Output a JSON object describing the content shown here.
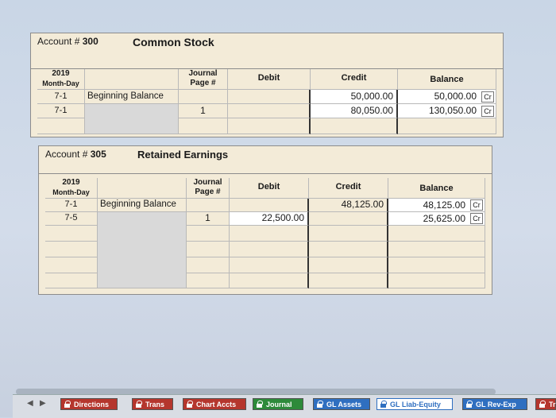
{
  "account1": {
    "label_prefix": "Account #",
    "number": "300",
    "name": "Common Stock",
    "headers": {
      "year": "2019",
      "month_day": "Month-Day",
      "journal": "Journal",
      "page": "Page #",
      "debit": "Debit",
      "credit": "Credit",
      "balance": "Balance"
    },
    "rows": [
      {
        "date": "7-1",
        "desc": "Beginning Balance",
        "page": "",
        "debit": "",
        "credit": "50,000.00",
        "balance": "50,000.00",
        "side": "Cr"
      },
      {
        "date": "7-1",
        "desc": "",
        "page": "1",
        "debit": "",
        "credit": "80,050.00",
        "balance": "130,050.00",
        "side": "Cr"
      }
    ]
  },
  "account2": {
    "label_prefix": "Account #",
    "number": "305",
    "name": "Retained Earnings",
    "headers": {
      "year": "2019",
      "month_day": "Month-Day",
      "journal": "Journal",
      "page": "Page #",
      "debit": "Debit",
      "credit": "Credit",
      "balance": "Balance"
    },
    "rows": [
      {
        "date": "7-1",
        "desc": "Beginning Balance",
        "page": "",
        "debit": "",
        "credit": "48,125.00",
        "balance": "48,125.00",
        "side": "Cr"
      },
      {
        "date": "7-5",
        "desc": "",
        "page": "1",
        "debit": "22,500.00",
        "credit": "",
        "balance": "25,625.00",
        "side": "Cr"
      }
    ]
  },
  "tabs": [
    {
      "label": "Directions",
      "color": "#b5362d"
    },
    {
      "label": "Trans",
      "color": "#b5362d"
    },
    {
      "label": "Chart Accts",
      "color": "#b5362d"
    },
    {
      "label": "Journal",
      "color": "#2d8a3a"
    },
    {
      "label": "GL Assets",
      "color": "#2f6fc0"
    },
    {
      "label": "GL Liab-Equity",
      "color": "#2f6fc0"
    },
    {
      "label": "GL Rev-Exp",
      "color": "#2f6fc0"
    },
    {
      "label": "Tri",
      "color": "#b5362d"
    }
  ]
}
